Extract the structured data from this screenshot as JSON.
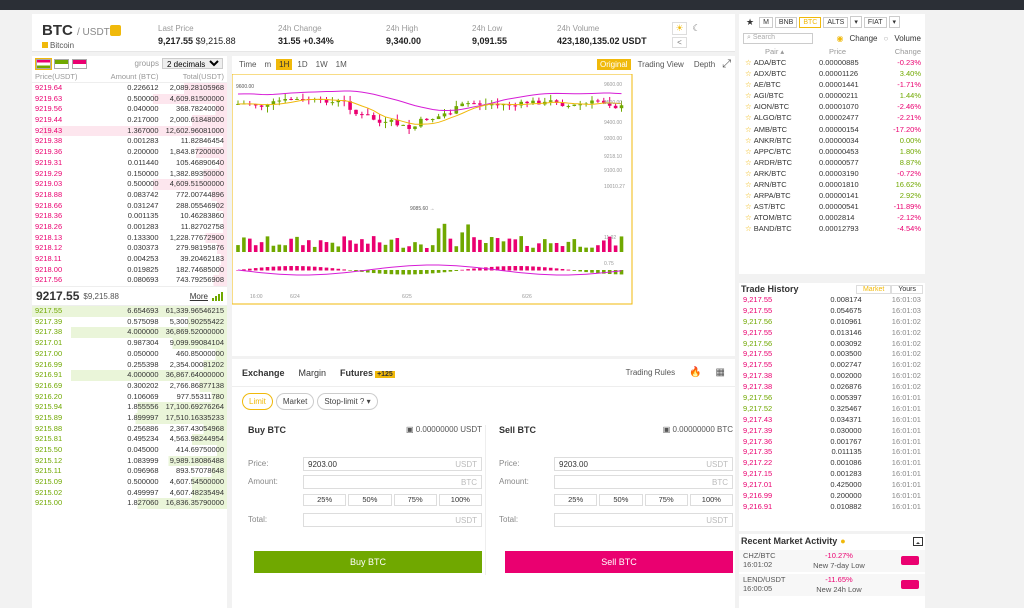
{
  "header": {
    "pair": "BTC",
    "quote": "/ USDT",
    "name": "Bitcoin",
    "last_label": "Last Price",
    "last_value": "9,217.55",
    "last_usd": "$9,215.88",
    "change_label": "24h Change",
    "change_value": "31.55 +0.34%",
    "high_label": "24h High",
    "high_value": "9,340.00",
    "low_label": "24h Low",
    "low_value": "9,091.55",
    "vol_label": "24h Volume",
    "vol_value": "423,180,135.02 USDT"
  },
  "orderbook": {
    "groups_label": "groups",
    "groups_value": "2 decimals",
    "headers": [
      "Price(USDT)",
      "Amount (BTC)",
      "Total(USDT)"
    ],
    "asks": [
      [
        "9219.64",
        "0.226612",
        "2,089.28105968",
        22
      ],
      [
        "9219.63",
        "0.500000",
        "4,609.81500000",
        38
      ],
      [
        "9219.56",
        "0.040000",
        "368.78240000",
        6
      ],
      [
        "9219.44",
        "0.217000",
        "2,000.61848000",
        18
      ],
      [
        "9219.43",
        "1.367000",
        "12,602.96081000",
        95
      ],
      [
        "9219.38",
        "0.001283",
        "11.82846454",
        2
      ],
      [
        "9219.36",
        "0.200000",
        "1,843.87200000",
        16
      ],
      [
        "9219.31",
        "0.011440",
        "105.46890640",
        4
      ],
      [
        "9219.29",
        "0.150000",
        "1,382.89350000",
        12
      ],
      [
        "9219.03",
        "0.500000",
        "4,609.51500000",
        38
      ],
      [
        "9218.88",
        "0.083742",
        "772.00744896",
        8
      ],
      [
        "9218.66",
        "0.031247",
        "288.05546902",
        5
      ],
      [
        "9218.36",
        "0.001135",
        "10.46283860",
        2
      ],
      [
        "9218.26",
        "0.001283",
        "11.82702758",
        2
      ],
      [
        "9218.13",
        "0.133300",
        "1,228.77672900",
        11
      ],
      [
        "9218.12",
        "0.030373",
        "279.98195876",
        5
      ],
      [
        "9218.11",
        "0.004253",
        "39.20462183",
        3
      ],
      [
        "9218.00",
        "0.019825",
        "182.74685000",
        4
      ],
      [
        "9217.56",
        "0.080693",
        "743.79256908",
        7
      ]
    ],
    "last_price": "9217.55",
    "last_usd": "$9,215.88",
    "more": "More",
    "bids": [
      [
        "9217.55",
        "6.654693",
        "61,339.96546215",
        100
      ],
      [
        "9217.39",
        "0.575098",
        "5,300.90255422",
        20
      ],
      [
        "9217.38",
        "4.000000",
        "36,869.52000000",
        80
      ],
      [
        "9217.01",
        "0.987304",
        "9,099.99084104",
        28
      ],
      [
        "9217.00",
        "0.050000",
        "460.85000000",
        6
      ],
      [
        "9216.99",
        "0.255398",
        "2,354.00081202",
        12
      ],
      [
        "9216.91",
        "4.000000",
        "36,867.64000000",
        80
      ],
      [
        "9216.69",
        "0.300202",
        "2,766.86877138",
        14
      ],
      [
        "9216.20",
        "0.106069",
        "977.55311780",
        8
      ],
      [
        "9215.94",
        "1.855556",
        "17,100.69276264",
        46
      ],
      [
        "9215.89",
        "1.899997",
        "17,510.16335233",
        47
      ],
      [
        "9215.88",
        "0.256886",
        "2,367.43054968",
        12
      ],
      [
        "9215.81",
        "0.495234",
        "4,563.98244954",
        18
      ],
      [
        "9215.50",
        "0.045000",
        "414.69750000",
        5
      ],
      [
        "9215.12",
        "1.083999",
        "9,989.18086488",
        30
      ],
      [
        "9215.11",
        "0.096968",
        "893.57078648",
        8
      ],
      [
        "9215.09",
        "0.500000",
        "4,607.54500000",
        18
      ],
      [
        "9215.02",
        "0.499997",
        "4,607.48235494",
        18
      ],
      [
        "9215.00",
        "1.827060",
        "16,836.35790000",
        46
      ]
    ]
  },
  "chart": {
    "toolbar": [
      "Time",
      "m",
      "1H",
      "1D",
      "1W",
      "1M"
    ],
    "views": [
      "Original",
      "Trading View",
      "Depth"
    ],
    "prices": [
      "9600.00",
      "9500.00",
      "9400.00",
      "9300.00",
      "9218.10",
      "9100.00",
      "10010.27",
      "11.92",
      "0.75"
    ],
    "high_mark": "9600.00",
    "low_mark": "9085.60",
    "dates": [
      "16:00",
      "6/24",
      "6/25",
      "6/26"
    ]
  },
  "trade": {
    "tabs": [
      "Exchange",
      "Margin",
      "Futures"
    ],
    "futures_badge": "+125",
    "rules": "Trading Rules",
    "types": [
      "Limit",
      "Market",
      "Stop-limit"
    ],
    "buy_title": "Buy BTC",
    "buy_balance": "0.00000000 USDT",
    "sell_title": "Sell BTC",
    "sell_balance": "0.00000000 BTC",
    "price_label": "Price:",
    "amount_label": "Amount:",
    "total_label": "Total:",
    "price_value": "9203.00",
    "unit_usdt": "USDT",
    "unit_btc": "BTC",
    "pcts": [
      "25%",
      "50%",
      "75%",
      "100%"
    ],
    "buy_btn": "Buy BTC",
    "sell_btn": "Sell BTC",
    "buy_color": "#70a800",
    "sell_color": "#ea0070"
  },
  "markets": {
    "tabs": [
      "M",
      "BNB",
      "BTC",
      "ALTS",
      "FIAT"
    ],
    "search": "Search",
    "change": "Change",
    "volume": "Volume",
    "headers": [
      "Pair",
      "Price",
      "Change"
    ],
    "rows": [
      [
        "ADA/BTC",
        "0.00000885",
        "-0.23%"
      ],
      [
        "ADX/BTC",
        "0.00001126",
        "3.40%"
      ],
      [
        "AE/BTC",
        "0.00001441",
        "-1.71%"
      ],
      [
        "AGI/BTC",
        "0.00000211",
        "1.44%"
      ],
      [
        "AION/BTC",
        "0.00001070",
        "-2.46%"
      ],
      [
        "ALGO/BTC",
        "0.00002477",
        "-2.21%"
      ],
      [
        "AMB/BTC",
        "0.00000154",
        "-17.20%"
      ],
      [
        "ANKR/BTC",
        "0.00000034",
        "0.00%"
      ],
      [
        "APPC/BTC",
        "0.00000453",
        "1.80%"
      ],
      [
        "ARDR/BTC",
        "0.00000577",
        "8.87%"
      ],
      [
        "ARK/BTC",
        "0.00003190",
        "-0.72%"
      ],
      [
        "ARN/BTC",
        "0.00001810",
        "16.62%"
      ],
      [
        "ARPA/BTC",
        "0.00000141",
        "2.92%"
      ],
      [
        "AST/BTC",
        "0.00000541",
        "-11.89%"
      ],
      [
        "ATOM/BTC",
        "0.0002814",
        "-2.12%"
      ],
      [
        "BAND/BTC",
        "0.00012793",
        "-4.54%"
      ]
    ]
  },
  "history": {
    "title": "Trade History",
    "tabs": [
      "Market",
      "Yours"
    ],
    "rows": [
      [
        "9,217.55",
        "0.008174",
        "16:01:03",
        "r"
      ],
      [
        "9,217.55",
        "0.054675",
        "16:01:03",
        "r"
      ],
      [
        "9,217.56",
        "0.010961",
        "16:01:02",
        "g"
      ],
      [
        "9,217.55",
        "0.013146",
        "16:01:02",
        "r"
      ],
      [
        "9,217.56",
        "0.003092",
        "16:01:02",
        "g"
      ],
      [
        "9,217.55",
        "0.003500",
        "16:01:02",
        "r"
      ],
      [
        "9,217.55",
        "0.002747",
        "16:01:02",
        "r"
      ],
      [
        "9,217.38",
        "0.002000",
        "16:01:02",
        "r"
      ],
      [
        "9,217.38",
        "0.026876",
        "16:01:02",
        "r"
      ],
      [
        "9,217.56",
        "0.005397",
        "16:01:01",
        "g"
      ],
      [
        "9,217.52",
        "0.325467",
        "16:01:01",
        "g"
      ],
      [
        "9,217.43",
        "0.034371",
        "16:01:01",
        "r"
      ],
      [
        "9,217.39",
        "0.030000",
        "16:01:01",
        "r"
      ],
      [
        "9,217.36",
        "0.001767",
        "16:01:01",
        "r"
      ],
      [
        "9,217.35",
        "0.011135",
        "16:01:01",
        "r"
      ],
      [
        "9,217.22",
        "0.001086",
        "16:01:01",
        "r"
      ],
      [
        "9,217.15",
        "0.001283",
        "16:01:01",
        "r"
      ],
      [
        "9,217.01",
        "0.425000",
        "16:01:01",
        "r"
      ],
      [
        "9,216.99",
        "0.200000",
        "16:01:01",
        "r"
      ],
      [
        "9,216.91",
        "0.010882",
        "16:01:01",
        "r"
      ]
    ]
  },
  "activity": {
    "title": "Recent Market Activity",
    "rows": [
      [
        "CHZ/BTC",
        "16:01:02",
        "-10.27%",
        "New 7-day Low"
      ],
      [
        "LEND/USDT",
        "16:00:05",
        "-11.65%",
        "New 24h Low"
      ]
    ]
  }
}
